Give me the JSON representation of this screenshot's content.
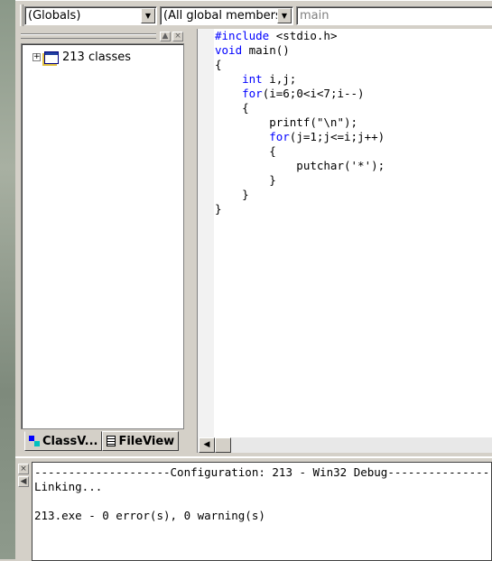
{
  "toolbar": {
    "scope": "(Globals)",
    "members": "(All global members",
    "function": "main"
  },
  "classview": {
    "root_label": "213 classes",
    "tabs": [
      {
        "label": "ClassV..."
      },
      {
        "label": "FileView"
      }
    ]
  },
  "editor": {
    "lines": [
      [
        {
          "t": "#include",
          "k": true
        },
        {
          "t": " <stdio.h>"
        }
      ],
      [
        {
          "t": "void",
          "k": true
        },
        {
          "t": " main()"
        }
      ],
      [
        {
          "t": "{"
        }
      ],
      [
        {
          "t": "    "
        },
        {
          "t": "int",
          "k": true
        },
        {
          "t": " i,j;"
        }
      ],
      [
        {
          "t": "    "
        },
        {
          "t": "for",
          "k": true
        },
        {
          "t": "(i=6;0<i<7;i--)"
        }
      ],
      [
        {
          "t": "    {"
        }
      ],
      [
        {
          "t": "        printf(\"\\n\");"
        }
      ],
      [
        {
          "t": "        "
        },
        {
          "t": "for",
          "k": true
        },
        {
          "t": "(j=1;j<=i;j++)"
        }
      ],
      [
        {
          "t": "        {"
        }
      ],
      [
        {
          "t": "            putchar('*');"
        }
      ],
      [
        {
          "t": "        }"
        }
      ],
      [
        {
          "t": "    }"
        }
      ],
      [
        {
          "t": "}"
        }
      ]
    ],
    "keyword_color": "#0000ff"
  },
  "output": {
    "lines": [
      "--------------------Configuration: 213 - Win32 Debug--------------------",
      "Linking...",
      "",
      "213.exe - 0 error(s), 0 warning(s)"
    ]
  }
}
